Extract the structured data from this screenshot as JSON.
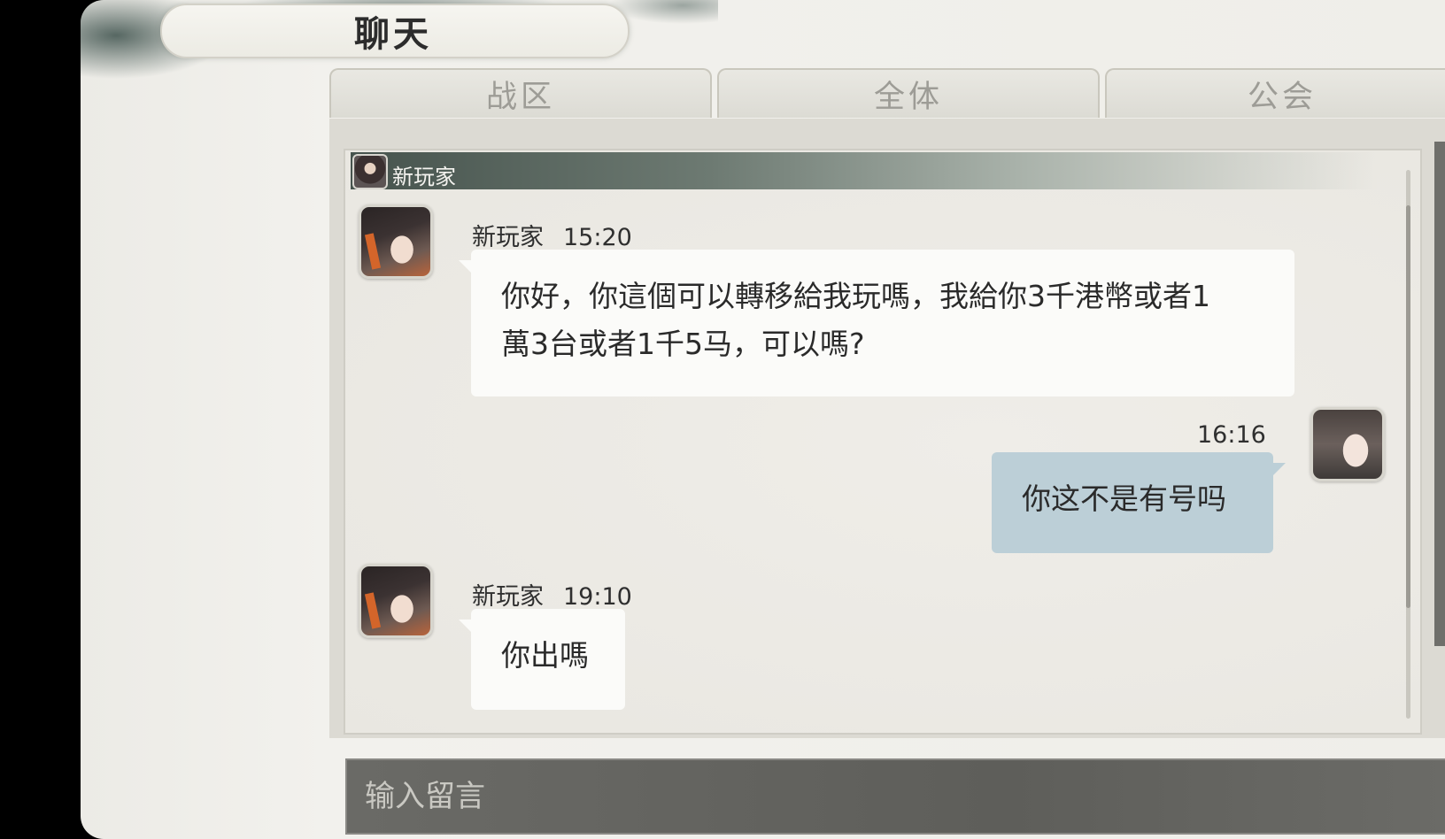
{
  "header": {
    "title": "聊天"
  },
  "tabs": [
    {
      "label": "战区"
    },
    {
      "label": "全体"
    },
    {
      "label": "公会"
    }
  ],
  "channel": {
    "name": "新玩家"
  },
  "messages": [
    {
      "sender": "新玩家",
      "time": "15:20",
      "text": "你好，你這個可以轉移給我玩嗎，我給你3千港幣或者1萬3台或者1千5马，可以嗎?",
      "line1": "你好，你這個可以轉移給我玩嗎，我給你3千港幣或者1",
      "line2": "萬3台或者1千5马，可以嗎?",
      "side": "left"
    },
    {
      "sender": "",
      "time": "16:16",
      "text": "你这不是有号吗",
      "side": "right"
    },
    {
      "sender": "新玩家",
      "time": "19:10",
      "text": "你出嗎",
      "side": "left"
    }
  ],
  "input": {
    "placeholder": "输入留言",
    "value": ""
  },
  "colors": {
    "own_bubble": "#bccfd7",
    "other_bubble": "#fbfbf9",
    "input_bar": "#5e5e5a"
  }
}
